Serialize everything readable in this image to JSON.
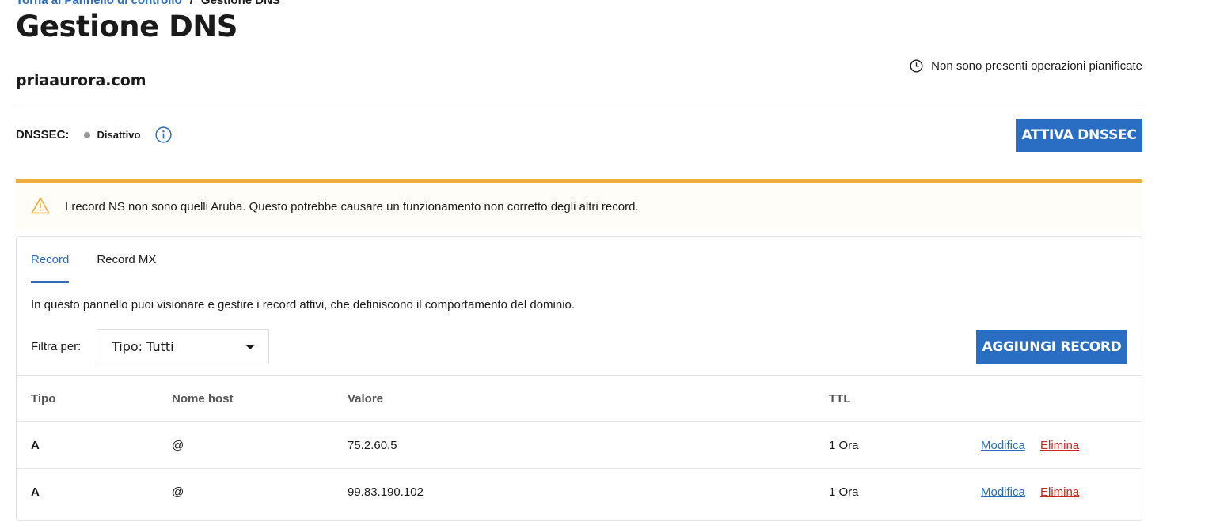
{
  "breadcrumb": {
    "back_link": "Torna al Pannello di controllo",
    "separator": "/",
    "current": "Gestione DNS"
  },
  "page": {
    "title": "Gestione DNS",
    "domain": "priaaurora.com",
    "scheduled_text": "Non sono presenti operazioni pianificate"
  },
  "dnssec": {
    "label": "DNSSEC:",
    "status": "Disattivo",
    "status_color": "#999999",
    "button": "ATTIVA DNSSEC"
  },
  "warning": {
    "text": "I record NS non sono quelli Aruba. Questo potrebbe causare un funzionamento non corretto degli altri record.",
    "accent_color": "#f0ad3c"
  },
  "tabs": [
    {
      "label": "Record",
      "active": true
    },
    {
      "label": "Record MX",
      "active": false
    }
  ],
  "panel": {
    "description": "In questo pannello puoi visionare e gestire i record attivi, che definiscono il comportamento del dominio.",
    "filter_label": "Filtra per:",
    "filter_value": "Tipo: Tutti",
    "add_button": "AGGIUNGI RECORD"
  },
  "table": {
    "headers": [
      "Tipo",
      "Nome host",
      "Valore",
      "TTL"
    ],
    "rows": [
      {
        "type": "A",
        "host": "@",
        "value": "75.2.60.5",
        "ttl": "1 Ora",
        "edit": "Modifica",
        "delete": "Elimina"
      },
      {
        "type": "A",
        "host": "@",
        "value": "99.83.190.102",
        "ttl": "1 Ora",
        "edit": "Modifica",
        "delete": "Elimina"
      }
    ]
  },
  "colors": {
    "primary": "#2a6ec4",
    "link": "#2b6cb8",
    "danger": "#c8281e"
  }
}
